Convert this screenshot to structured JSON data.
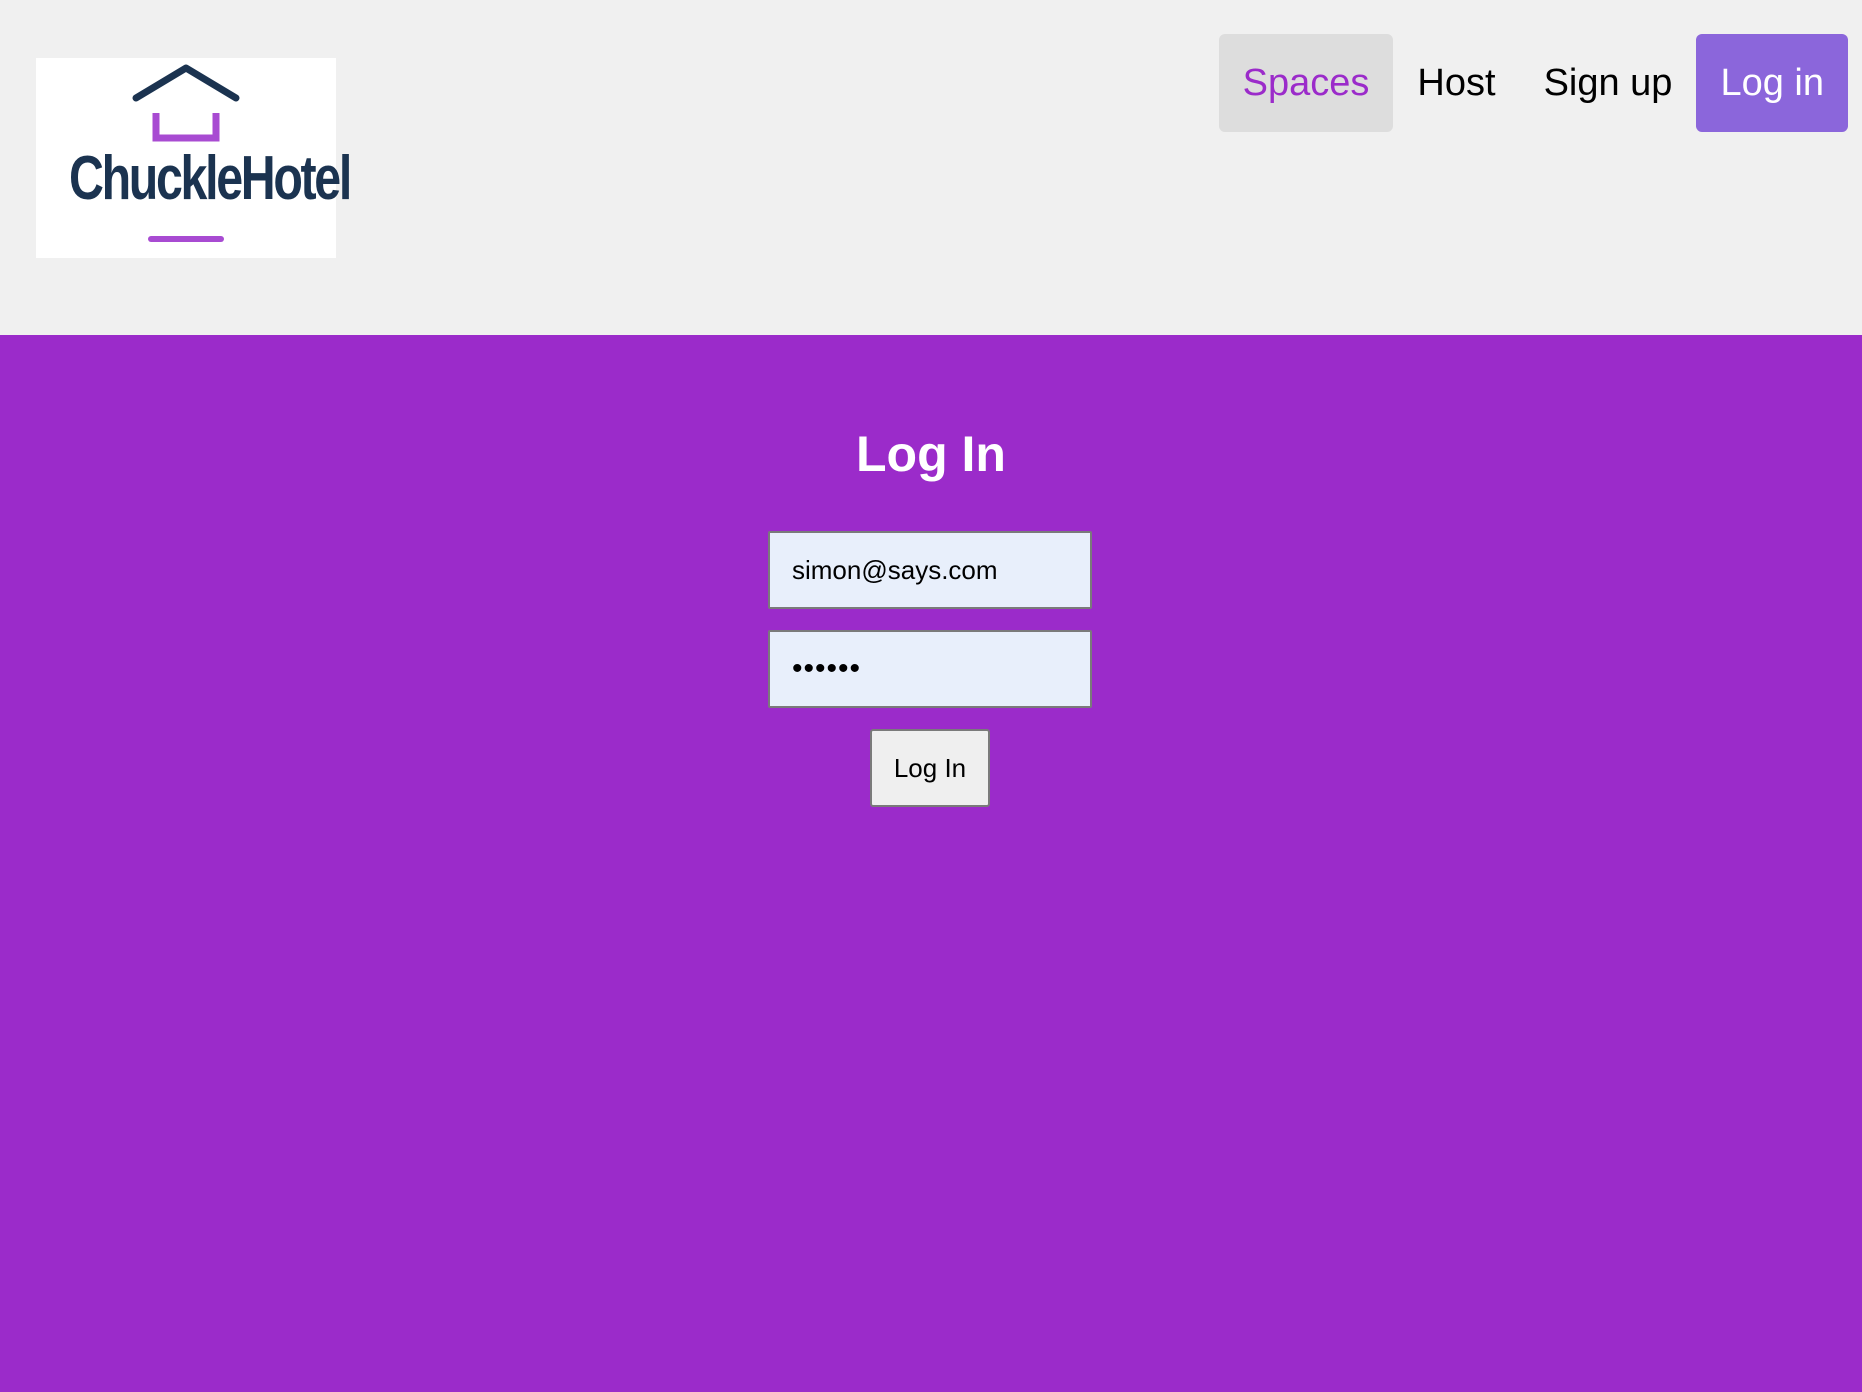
{
  "logo": {
    "text": "ChuckleHotel",
    "colors": {
      "house": "#1b3350",
      "accent": "#a84bd2"
    }
  },
  "nav": {
    "items": [
      {
        "label": "Spaces",
        "state": "active"
      },
      {
        "label": "Host",
        "state": "default"
      },
      {
        "label": "Sign up",
        "state": "default"
      },
      {
        "label": "Log in",
        "state": "primary"
      }
    ]
  },
  "login": {
    "heading": "Log In",
    "email_value": "simon@says.com",
    "password_value": "••••••",
    "submit_label": "Log In"
  },
  "colors": {
    "page_background": "#9b2bca",
    "header_background": "#f0f0f0",
    "nav_primary": "#8b66db",
    "nav_active_text": "#9b2bca",
    "input_background": "#e8effb"
  }
}
